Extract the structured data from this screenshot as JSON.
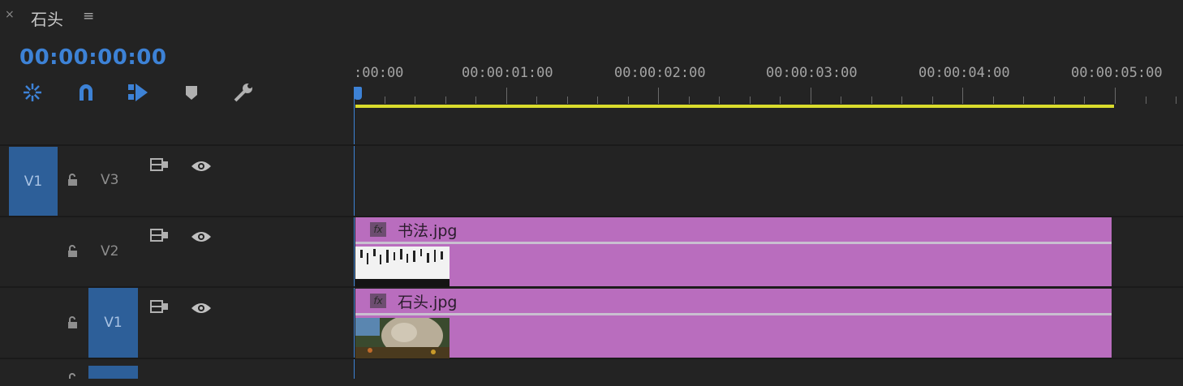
{
  "header": {
    "close_glyph": "×",
    "sequence_title": "石头",
    "menu_glyph": "≡"
  },
  "timecode": "00:00:00:00",
  "toolbar": {
    "icons": [
      "nest-sequence-icon",
      "snap-icon",
      "linked-selection-icon",
      "add-marker-icon",
      "timeline-settings-icon"
    ]
  },
  "ruler": {
    "labels": [
      ":00:00",
      "00:00:01:00",
      "00:00:02:00",
      "00:00:03:00",
      "00:00:04:00",
      "00:00:05:00"
    ]
  },
  "tracks": [
    {
      "source_patch": "V1",
      "name": "V3",
      "target": ""
    },
    {
      "source_patch": "",
      "name": "V2",
      "target": ""
    },
    {
      "source_patch": "",
      "name": "V1",
      "target": "V1"
    }
  ],
  "clips": [
    {
      "fx": "fx",
      "name": "书法.jpg",
      "track": "V2"
    },
    {
      "fx": "fx",
      "name": "石头.jpg",
      "track": "V1"
    }
  ],
  "colors": {
    "accent": "#3d82d6",
    "clip": "#b96dbe",
    "work_area": "#d9dc2c"
  }
}
